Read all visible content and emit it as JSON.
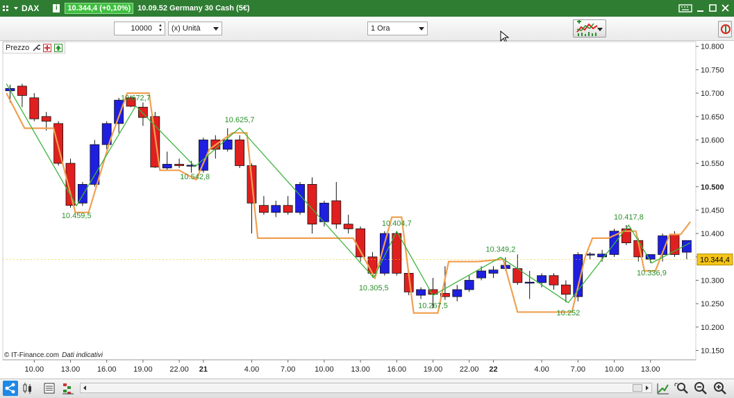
{
  "window": {
    "symbol": "DAX",
    "info_icon": "i",
    "price_badge": "10.344,4 (+0,10%)",
    "title": "10.09.52 Germany 30 Cash (5€)"
  },
  "toolbar": {
    "quantity": "10000",
    "unit_select": "(x) Unità",
    "timeframe_select": "1 Ora"
  },
  "panel": {
    "label": "Prezzo"
  },
  "footer": {
    "copyright": "© IT-Finance.com",
    "note": "Dati indicativi"
  },
  "colors": {
    "window_green": "#2e7d32",
    "bull": "#1f1fe0",
    "bear": "#e01f1f",
    "zigzag": "#3cb43c",
    "envelope": "#f0a050",
    "current_price": "#f5c518"
  },
  "chart_data": {
    "type": "candlestick",
    "y_ticks": [
      "10.800",
      "10.750",
      "10.700",
      "10.650",
      "10.600",
      "10.550",
      "10.500",
      "10.450",
      "10.400",
      "10.350",
      "10.300",
      "10.250",
      "10.200",
      "10.150"
    ],
    "y_bold_tick": "10.500",
    "ylim": [
      10130,
      10810
    ],
    "current_price": 10344.4,
    "current_price_label": "10.344,4",
    "x_ticks": [
      {
        "label": "10.00",
        "index": 2
      },
      {
        "label": "13.00",
        "index": 5
      },
      {
        "label": "16.00",
        "index": 8
      },
      {
        "label": "19.00",
        "index": 11
      },
      {
        "label": "22.00",
        "index": 14
      },
      {
        "label": "21",
        "index": 16,
        "bold": true
      },
      {
        "label": "4.00",
        "index": 20
      },
      {
        "label": "7.00",
        "index": 23
      },
      {
        "label": "10.00",
        "index": 26
      },
      {
        "label": "13.00",
        "index": 29
      },
      {
        "label": "16.00",
        "index": 32
      },
      {
        "label": "19.00",
        "index": 35
      },
      {
        "label": "22.00",
        "index": 38
      },
      {
        "label": "22",
        "index": 40,
        "bold": true
      },
      {
        "label": "4.00",
        "index": 44
      },
      {
        "label": "7.00",
        "index": 47
      },
      {
        "label": "10.00",
        "index": 50
      },
      {
        "label": "13.00",
        "index": 53
      }
    ],
    "candles": [
      {
        "o": 10705,
        "h": 10718,
        "l": 10680,
        "c": 10710
      },
      {
        "o": 10715,
        "h": 10720,
        "l": 10670,
        "c": 10695
      },
      {
        "o": 10690,
        "h": 10700,
        "l": 10640,
        "c": 10645
      },
      {
        "o": 10650,
        "h": 10660,
        "l": 10620,
        "c": 10640
      },
      {
        "o": 10635,
        "h": 10640,
        "l": 10545,
        "c": 10550
      },
      {
        "o": 10550,
        "h": 10560,
        "l": 10455,
        "c": 10460
      },
      {
        "o": 10465,
        "h": 10510,
        "l": 10459,
        "c": 10505
      },
      {
        "o": 10505,
        "h": 10600,
        "l": 10500,
        "c": 10590
      },
      {
        "o": 10590,
        "h": 10640,
        "l": 10580,
        "c": 10635
      },
      {
        "o": 10635,
        "h": 10690,
        "l": 10615,
        "c": 10685
      },
      {
        "o": 10690,
        "h": 10695,
        "l": 10670,
        "c": 10672
      },
      {
        "o": 10670,
        "h": 10680,
        "l": 10630,
        "c": 10648
      },
      {
        "o": 10650,
        "h": 10660,
        "l": 10540,
        "c": 10542
      },
      {
        "o": 10540,
        "h": 10575,
        "l": 10535,
        "c": 10548
      },
      {
        "o": 10548,
        "h": 10560,
        "l": 10540,
        "c": 10545
      },
      {
        "o": 10545,
        "h": 10555,
        "l": 10530,
        "c": 10546
      },
      {
        "o": 10535,
        "h": 10605,
        "l": 10530,
        "c": 10600
      },
      {
        "o": 10600,
        "h": 10610,
        "l": 10560,
        "c": 10580
      },
      {
        "o": 10580,
        "h": 10625,
        "l": 10575,
        "c": 10600
      },
      {
        "o": 10600,
        "h": 10610,
        "l": 10540,
        "c": 10545
      },
      {
        "o": 10545,
        "h": 10550,
        "l": 10400,
        "c": 10465
      },
      {
        "o": 10460,
        "h": 10480,
        "l": 10440,
        "c": 10445
      },
      {
        "o": 10445,
        "h": 10470,
        "l": 10435,
        "c": 10460
      },
      {
        "o": 10460,
        "h": 10480,
        "l": 10440,
        "c": 10445
      },
      {
        "o": 10445,
        "h": 10510,
        "l": 10440,
        "c": 10505
      },
      {
        "o": 10505,
        "h": 10520,
        "l": 10400,
        "c": 10420
      },
      {
        "o": 10425,
        "h": 10470,
        "l": 10415,
        "c": 10465
      },
      {
        "o": 10470,
        "h": 10510,
        "l": 10410,
        "c": 10420
      },
      {
        "o": 10420,
        "h": 10440,
        "l": 10400,
        "c": 10410
      },
      {
        "o": 10410,
        "h": 10415,
        "l": 10340,
        "c": 10350
      },
      {
        "o": 10350,
        "h": 10360,
        "l": 10306,
        "c": 10315
      },
      {
        "o": 10315,
        "h": 10405,
        "l": 10310,
        "c": 10400
      },
      {
        "o": 10400,
        "h": 10405,
        "l": 10310,
        "c": 10315
      },
      {
        "o": 10315,
        "h": 10320,
        "l": 10268,
        "c": 10275
      },
      {
        "o": 10268,
        "h": 10285,
        "l": 10260,
        "c": 10280
      },
      {
        "o": 10280,
        "h": 10305,
        "l": 10240,
        "c": 10270
      },
      {
        "o": 10272,
        "h": 10330,
        "l": 10258,
        "c": 10265
      },
      {
        "o": 10265,
        "h": 10290,
        "l": 10255,
        "c": 10280
      },
      {
        "o": 10280,
        "h": 10310,
        "l": 10275,
        "c": 10300
      },
      {
        "o": 10305,
        "h": 10330,
        "l": 10300,
        "c": 10320
      },
      {
        "o": 10315,
        "h": 10330,
        "l": 10305,
        "c": 10322
      },
      {
        "o": 10325,
        "h": 10349,
        "l": 10320,
        "c": 10332
      },
      {
        "o": 10325,
        "h": 10355,
        "l": 10290,
        "c": 10295
      },
      {
        "o": 10295,
        "h": 10320,
        "l": 10260,
        "c": 10296
      },
      {
        "o": 10295,
        "h": 10315,
        "l": 10285,
        "c": 10310
      },
      {
        "o": 10310,
        "h": 10315,
        "l": 10280,
        "c": 10290
      },
      {
        "o": 10290,
        "h": 10300,
        "l": 10253,
        "c": 10270
      },
      {
        "o": 10265,
        "h": 10360,
        "l": 10255,
        "c": 10355
      },
      {
        "o": 10355,
        "h": 10360,
        "l": 10345,
        "c": 10356
      },
      {
        "o": 10350,
        "h": 10365,
        "l": 10340,
        "c": 10356
      },
      {
        "o": 10355,
        "h": 10410,
        "l": 10350,
        "c": 10405
      },
      {
        "o": 10410,
        "h": 10418,
        "l": 10375,
        "c": 10380
      },
      {
        "o": 10385,
        "h": 10390,
        "l": 10340,
        "c": 10350
      },
      {
        "o": 10345,
        "h": 10355,
        "l": 10337,
        "c": 10355
      },
      {
        "o": 10355,
        "h": 10400,
        "l": 10340,
        "c": 10395
      },
      {
        "o": 10398,
        "h": 10405,
        "l": 10350,
        "c": 10355
      },
      {
        "o": 10360,
        "h": 10385,
        "l": 10345,
        "c": 10385
      }
    ],
    "zigzag_points": [
      {
        "i": -0.3,
        "v": 10720
      },
      {
        "i": 5.5,
        "v": 10459.5
      },
      {
        "i": 10.4,
        "v": 10672.7
      },
      {
        "i": 15.3,
        "v": 10542.8
      },
      {
        "i": 19.0,
        "v": 10625.7
      },
      {
        "i": 30.1,
        "v": 10305.5
      },
      {
        "i": 32.0,
        "v": 10404.7
      },
      {
        "i": 35.0,
        "v": 10267.5
      },
      {
        "i": 40.6,
        "v": 10349.2
      },
      {
        "i": 46.2,
        "v": 10252
      },
      {
        "i": 51.2,
        "v": 10417.8
      },
      {
        "i": 53.1,
        "v": 10336.9
      },
      {
        "i": 56.3,
        "v": 10380
      }
    ],
    "envelope_points": [
      {
        "i": -0.3,
        "v": 10700
      },
      {
        "i": 1.2,
        "v": 10625
      },
      {
        "i": 3.6,
        "v": 10625
      },
      {
        "i": 5.4,
        "v": 10445
      },
      {
        "i": 6.5,
        "v": 10445
      },
      {
        "i": 8.3,
        "v": 10600
      },
      {
        "i": 9.7,
        "v": 10700
      },
      {
        "i": 11.5,
        "v": 10700
      },
      {
        "i": 12.4,
        "v": 10535
      },
      {
        "i": 14.0,
        "v": 10535
      },
      {
        "i": 15.4,
        "v": 10515
      },
      {
        "i": 16.5,
        "v": 10580
      },
      {
        "i": 18.4,
        "v": 10615
      },
      {
        "i": 19.6,
        "v": 10615
      },
      {
        "i": 20.5,
        "v": 10390
      },
      {
        "i": 28.4,
        "v": 10390
      },
      {
        "i": 30.2,
        "v": 10305
      },
      {
        "i": 31.6,
        "v": 10435
      },
      {
        "i": 32.4,
        "v": 10435
      },
      {
        "i": 33.4,
        "v": 10230
      },
      {
        "i": 35.4,
        "v": 10230
      },
      {
        "i": 36.3,
        "v": 10340
      },
      {
        "i": 38.7,
        "v": 10340
      },
      {
        "i": 40.8,
        "v": 10345
      },
      {
        "i": 42.0,
        "v": 10232
      },
      {
        "i": 46.5,
        "v": 10232
      },
      {
        "i": 47.6,
        "v": 10350
      },
      {
        "i": 48.2,
        "v": 10390
      },
      {
        "i": 49.5,
        "v": 10390
      },
      {
        "i": 50.8,
        "v": 10405
      },
      {
        "i": 51.8,
        "v": 10405
      },
      {
        "i": 52.5,
        "v": 10320
      },
      {
        "i": 53.4,
        "v": 10320
      },
      {
        "i": 54.6,
        "v": 10398
      },
      {
        "i": 55.5,
        "v": 10398
      },
      {
        "i": 56.3,
        "v": 10425
      }
    ],
    "annotations": [
      {
        "text": "10.459,5",
        "i": 5.5,
        "v": 10459.5,
        "pos": "below"
      },
      {
        "text": "10.672,7",
        "i": 10.4,
        "v": 10672.7,
        "pos": "above"
      },
      {
        "text": "10.542,8",
        "i": 15.3,
        "v": 10542.8,
        "pos": "below"
      },
      {
        "text": "10.625,7",
        "i": 19.0,
        "v": 10625.7,
        "pos": "above"
      },
      {
        "text": "10.305,5",
        "i": 30.1,
        "v": 10305.5,
        "pos": "below"
      },
      {
        "text": "10.404,7",
        "i": 32.0,
        "v": 10404.7,
        "pos": "above"
      },
      {
        "text": "10.267,5",
        "i": 35.0,
        "v": 10267.5,
        "pos": "below"
      },
      {
        "text": "10.349,2",
        "i": 40.6,
        "v": 10349.2,
        "pos": "above"
      },
      {
        "text": "10.252",
        "i": 46.2,
        "v": 10252,
        "pos": "below"
      },
      {
        "text": "10.417,8",
        "i": 51.2,
        "v": 10417.8,
        "pos": "above"
      },
      {
        "text": "10.336,9",
        "i": 53.1,
        "v": 10336.9,
        "pos": "below"
      }
    ]
  }
}
